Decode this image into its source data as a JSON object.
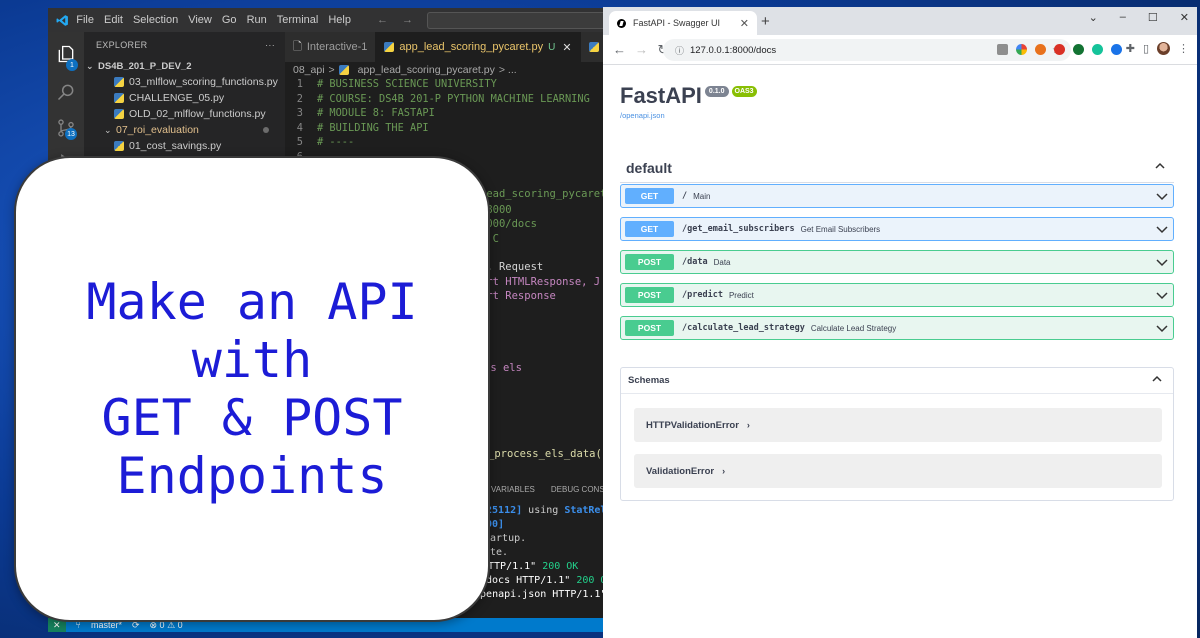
{
  "vscode": {
    "menu": [
      "File",
      "Edit",
      "Selection",
      "View",
      "Go",
      "Run",
      "Terminal",
      "Help"
    ],
    "explorer_label": "EXPLORER",
    "explorer_more": "···",
    "project": "DS4B_201_P_DEV_2",
    "files": [
      {
        "name": "03_mlflow_scoring_functions.py",
        "type": "py"
      },
      {
        "name": "CHALLENGE_05.py",
        "type": "py"
      },
      {
        "name": "OLD_02_mlflow_functions.py",
        "type": "py"
      },
      {
        "name": "07_roi_evaluation",
        "type": "folder"
      },
      {
        "name": "01_cost_savings.py",
        "type": "py"
      }
    ],
    "tabs": [
      {
        "label": "Interactive-1",
        "active": false
      },
      {
        "label": "app_lead_scoring_pycaret.py",
        "active": true,
        "modified": "U",
        "close": "✕"
      },
      {
        "label": "app_le",
        "active": false
      }
    ],
    "breadcrumb": {
      "folder": "08_api",
      "sep": ">",
      "file": "app_lead_scoring_pycaret.py",
      "more": "> ..."
    },
    "code_lines": [
      {
        "n": "1",
        "text": "# BUSINESS SCIENCE UNIVERSITY"
      },
      {
        "n": "2",
        "text": "# COURSE: DS4B 201-P PYTHON MACHINE LEARNING"
      },
      {
        "n": "3",
        "text": "# MODULE 8: FASTAPI"
      },
      {
        "n": "4",
        "text": "# BUILDING THE API"
      },
      {
        "n": "5",
        "text": "# ----"
      },
      {
        "n": "6",
        "text": ""
      }
    ],
    "code_fragments": [
      "lead_scoring_pycaret:a",
      ":8000",
      "8000/docs",
      " + C",
      "I, Request",
      "ort HTMLResponse, J",
      "ort Response",
      "as els",
      "_process_els_data()"
    ],
    "panel_tabs": [
      "VARIABLES",
      "DEBUG CONSOL"
    ],
    "terminal": {
      "l1_pid": "[25112]",
      "l1_mid": " using ",
      "l1_end": "StatRel",
      "l2": "000]",
      "l3": "tartup.",
      "l4": "ete.",
      "l5_path": " HTTP/1.1\"",
      "l5_code": " 200 OK",
      "l6_path": "/docs HTTP/1.1\"",
      "l6_code": " 200 OK",
      "l7_path": " /openapi.json HTTP/1.1\""
    },
    "status": {
      "branch": "master*",
      "problems": "⊗ 0 ⚠ 0"
    }
  },
  "overlay": {
    "lines": [
      "Make an API",
      "with",
      "GET & POST",
      "Endpoints"
    ]
  },
  "browser": {
    "tab_title": "FastAPI - Swagger UI",
    "tab_close": "✕",
    "new_tab": "+",
    "url": "127.0.0.1:8000/docs",
    "window_controls": [
      "⌄",
      "–",
      "☐",
      "✕"
    ]
  },
  "swagger": {
    "title": "FastAPI",
    "version": "0.1.0",
    "oas": "OAS3",
    "openapi_link": "/openapi.json",
    "tag": "default",
    "operations": [
      {
        "method": "GET",
        "path": "/",
        "summary": "Main"
      },
      {
        "method": "GET",
        "path": "/get_email_subscribers",
        "summary": "Get Email Subscribers"
      },
      {
        "method": "POST",
        "path": "/data",
        "summary": "Data"
      },
      {
        "method": "POST",
        "path": "/predict",
        "summary": "Predict"
      },
      {
        "method": "POST",
        "path": "/calculate_lead_strategy",
        "summary": "Calculate Lead Strategy"
      }
    ],
    "schemas_title": "Schemas",
    "models": [
      "HTTPValidationError",
      "ValidationError"
    ],
    "model_arrow": "›"
  },
  "colors": {
    "get": "#61affe",
    "post": "#49cc90",
    "overlay_text": "#1c1cd6",
    "vscode_status": "#007acc"
  }
}
